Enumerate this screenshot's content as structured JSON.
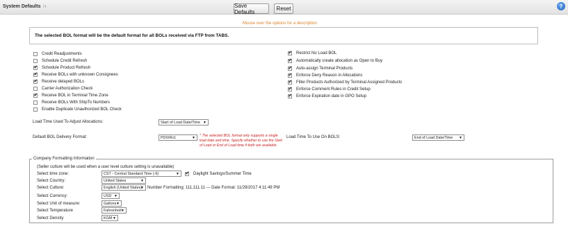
{
  "header": {
    "title": "System Defaults",
    "grip": "∷",
    "save_label": "Save Defaults",
    "reset_label": "Reset",
    "help_glyph": "?"
  },
  "hint": "Mouse over the options for a description.",
  "message": "The selected BOL format will be the default format for all BOLs received via FTP from TABS.",
  "options_left": [
    {
      "label": "Credit Readjustments",
      "checked": false
    },
    {
      "label": "Schedule Credit Refresh",
      "checked": false
    },
    {
      "label": "Schedule Product Refresh",
      "checked": true
    },
    {
      "label": "Receive BOLs with unknown Consignees",
      "checked": true
    },
    {
      "label": "Receive delayed BOLs",
      "checked": true
    },
    {
      "label": "Carrier Authorization Check",
      "checked": false
    },
    {
      "label": "Receive BOL in Terminal Time Zone",
      "checked": true
    },
    {
      "label": "Receive BOLs With ShipTo Numbers",
      "checked": false
    },
    {
      "label": "Enable Duplicate Unauthorized BOL Check",
      "checked": false
    }
  ],
  "options_right": [
    {
      "label": "Restrict No Load BOL",
      "checked": true
    },
    {
      "label": "Automatically create allocation as Open to Buy",
      "checked": true
    },
    {
      "label": "Auto-assign Terminal Products",
      "checked": true
    },
    {
      "label": "Enforce Deny Reason in Allocations",
      "checked": true
    },
    {
      "label": "Filter Products Authorized by Terminal Assigned Products",
      "checked": true
    },
    {
      "label": "Enforce Comment Rules in Credit Setup",
      "checked": true
    },
    {
      "label": "Enforce Expiration date in GPO Setup",
      "checked": true
    }
  ],
  "load_time": {
    "label": "Load Time Used To Adjust Allocations:",
    "value": "Start of Load Date/Time"
  },
  "bol_format": {
    "label": "Default BOL Delivery Format:",
    "value": "PDIXRv1",
    "warning": "* The selected BOL format only supports a single load date and time. Specify whether to use the Start of Load or End of Load time if both are available."
  },
  "load_time_bols": {
    "label": "Load Time To Use On BOLS:",
    "value": "End of Load Date/Time"
  },
  "company": {
    "legend": "Company Formatting Information",
    "note": "(Seller culture will be used when a user level culture setting is unavailable)",
    "timezone_label": "Select time zone:",
    "timezone_value": "CST - Central Standard Time (-6)",
    "dst_label": "Daylight Savings/Summer Time",
    "dst_checked": true,
    "country_label": "Select Country:",
    "country_value": "United States",
    "culture_label": "Select Culture:",
    "culture_value": "English (United States)",
    "format_info": "Number Formatting: 111,111.11 --- Date Format: 11/29/2017 4:11:49 PM",
    "currency_label": "Select Currency:",
    "currency_value": "USD",
    "uom_label": "Select Unit of measure:",
    "uom_value": "Gallons",
    "temp_label": "Select Temperature",
    "temp_value": "Fahrenheit",
    "density_label": "Select Density",
    "density_value": "KGM"
  },
  "dropdown_glyph": "▼"
}
